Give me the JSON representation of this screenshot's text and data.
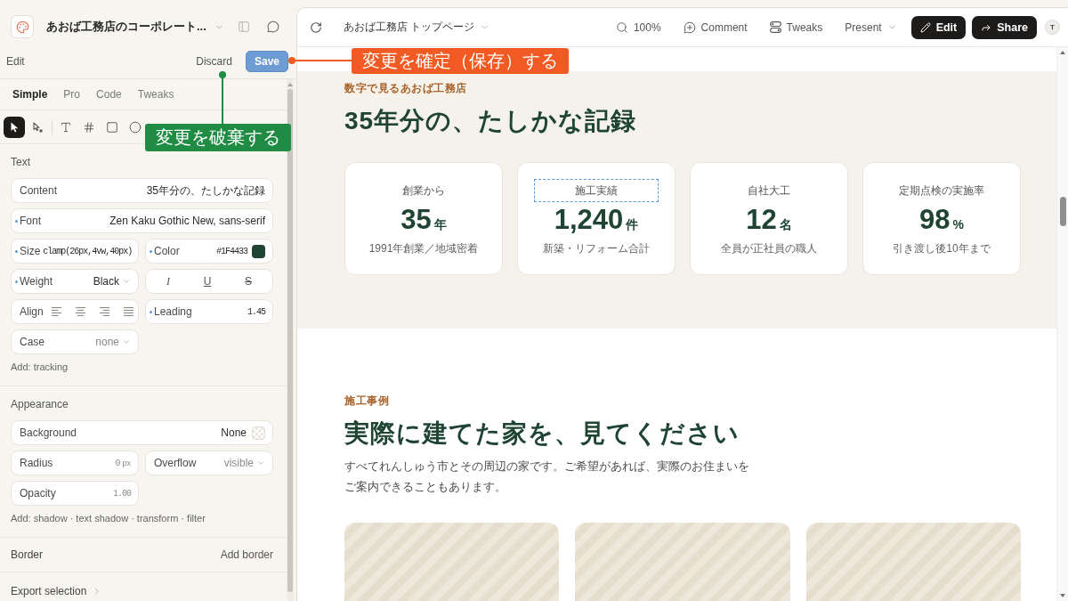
{
  "app": {
    "title": "あおば工務店のコーポレート..."
  },
  "edit_bar": {
    "title": "Edit",
    "discard": "Discard",
    "save": "Save"
  },
  "mode_tabs": [
    {
      "label": "Simple",
      "selected": true
    },
    {
      "label": "Pro",
      "selected": false
    },
    {
      "label": "Code",
      "selected": false
    },
    {
      "label": "Tweaks",
      "selected": false
    }
  ],
  "tool_groups": [
    [
      {
        "kind": "select",
        "selected": true
      },
      {
        "kind": "direct_select",
        "selected": false
      }
    ],
    [
      {
        "kind": "text",
        "selected": false
      },
      {
        "kind": "grid",
        "selected": false
      },
      {
        "kind": "rectangle",
        "selected": false
      },
      {
        "kind": "ellipse",
        "selected": false
      }
    ]
  ],
  "sections": [
    {
      "title": "Text",
      "rows": [
        [
          {
            "kind": "text",
            "label": "Content",
            "value": "35年分の、たしかな記録",
            "modified": false
          }
        ],
        [
          {
            "kind": "text",
            "label": "Font",
            "value": "Zen Kaku Gothic New, sans-serif",
            "modified": true
          }
        ],
        [
          {
            "kind": "code",
            "label": "Size",
            "value": "clamp(26px,4vw,40px)",
            "modified": true
          },
          {
            "kind": "color",
            "label": "Color",
            "value": "#1F4433",
            "color": "#1f4433",
            "modified": true
          }
        ],
        [
          {
            "kind": "select",
            "label": "Weight",
            "value": "Black",
            "modified": true
          },
          {
            "kind": "styles",
            "options": [
              {
                "kind": "italic",
                "label": "I"
              },
              {
                "kind": "underline",
                "label": "U"
              },
              {
                "kind": "strike",
                "label": "S"
              }
            ]
          }
        ],
        [
          {
            "kind": "align",
            "label": "Align",
            "modified": false
          },
          {
            "kind": "code",
            "label": "Leading",
            "value": "1.45",
            "modified": true
          }
        ],
        [
          {
            "kind": "select",
            "label": "Case",
            "placeholder": "none",
            "modified": false
          }
        ]
      ],
      "add": "Add: tracking"
    },
    {
      "title": "Appearance",
      "rows": [
        [
          {
            "kind": "fill",
            "label": "Background",
            "value": "None",
            "modified": false
          }
        ],
        [
          {
            "kind": "code",
            "label": "Radius",
            "placeholder": "0",
            "unit": "px",
            "modified": false
          },
          {
            "kind": "select",
            "label": "Overflow",
            "placeholder": "visible",
            "modified": false
          }
        ],
        [
          {
            "kind": "code",
            "label": "Opacity",
            "placeholder": "1.00",
            "modified": false
          }
        ]
      ],
      "add": "Add: shadow · text shadow · transform · filter"
    }
  ],
  "border": {
    "title": "Border",
    "action": "Add border"
  },
  "export": {
    "label": "Export selection"
  },
  "preview": {
    "page_title": "あおば工務店 トップページ",
    "toolbar": [
      {
        "kind": "zoom",
        "label": "100%"
      },
      {
        "kind": "comment",
        "label": "Comment"
      },
      {
        "kind": "tweaks",
        "label": "Tweaks"
      },
      {
        "kind": "present",
        "label": "Present"
      },
      {
        "kind": "edit",
        "label": "Edit"
      },
      {
        "kind": "share",
        "label": "Share"
      }
    ],
    "avatar": "T"
  },
  "stats_section": {
    "eyebrow": "数字で見るあおば工務店",
    "heading": "35年分の、たしかな記録",
    "stats": [
      {
        "label": "創業から",
        "value": "35",
        "unit": "年",
        "note": "1991年創業／地域密着",
        "highlighted": false
      },
      {
        "label": "施工実績",
        "value": "1,240",
        "unit": "件",
        "note": "新築・リフォーム合計",
        "highlighted": true
      },
      {
        "label": "自社大工",
        "value": "12",
        "unit": "名",
        "note": "全員が正社員の職人",
        "highlighted": false
      },
      {
        "label": "定期点検の実施率",
        "value": "98",
        "unit": "%",
        "note": "引き渡し後10年まで",
        "highlighted": false
      }
    ]
  },
  "works_section": {
    "eyebrow": "施工事例",
    "heading": "実際に建てた家を、見てください",
    "lines": [
      "すべてれんしゅう市とその周辺の家です。ご希望があれば、実際のお住まいを",
      "ご案内できることもあります。"
    ],
    "photos": [
      {
        "kind": "placeholder"
      },
      {
        "kind": "placeholder"
      },
      {
        "kind": "placeholder"
      }
    ]
  },
  "annotations": [
    {
      "kind": "save",
      "text": "変更を確定（保存）する",
      "color": "#f15a22"
    },
    {
      "kind": "discard",
      "text": "変更を破棄する",
      "color": "#1f8b43"
    }
  ]
}
